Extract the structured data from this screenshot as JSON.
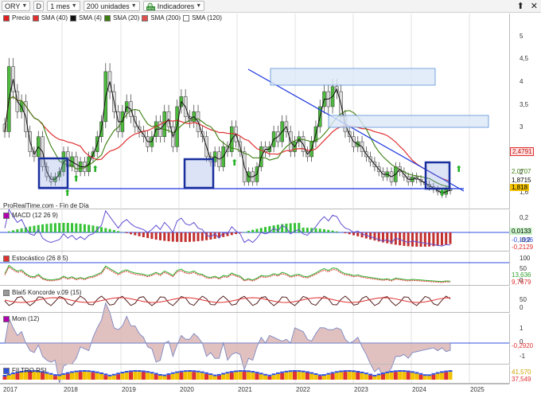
{
  "toolbar": {
    "ticker": "ORY",
    "d_label": "D",
    "period": "1 mes",
    "units": "200 unidades",
    "indicators": "Indicadores",
    "indicators_badge": "NEW"
  },
  "legend_main": [
    {
      "label": "Precio",
      "color": "#e02020"
    },
    {
      "label": "SMA (40)",
      "color": "#e03030"
    },
    {
      "label": "SMA (4)",
      "color": "#111111"
    },
    {
      "label": "SMA (20)",
      "color": "#3c7f10"
    },
    {
      "label": "SMA (200)",
      "color": "#e05050"
    },
    {
      "label": "SMA (120)",
      "color": "#ffffff"
    }
  ],
  "source_note": "ProRealTime.com - Fin de Día",
  "price_axis": [
    "5",
    "4,5",
    "4",
    "3,5",
    "3",
    "2",
    "1,6"
  ],
  "price_tags": [
    {
      "value": "2,4791",
      "color": "#e03030"
    },
    {
      "value": "2,0707",
      "color": "#3c7f10"
    },
    {
      "value": "1,8715",
      "color": "#111111"
    },
    {
      "value": "1,818",
      "color": "#f2c200"
    }
  ],
  "macd": {
    "title": "MACD (12 26 9)",
    "axis": [
      "0,2",
      "-0,2"
    ],
    "tags": [
      {
        "value": "0,0133",
        "color": "#30c030"
      },
      {
        "value": "-0,1996",
        "color": "#3050e0"
      },
      {
        "value": "-0,2129",
        "color": "#e03030"
      }
    ]
  },
  "stoch": {
    "title": "Estocástico (26 8 5)",
    "axis": [
      "100",
      "50",
      "0"
    ],
    "tags": [
      {
        "value": "13,636",
        "color": "#30c030"
      },
      {
        "value": "9,7679",
        "color": "#e03030"
      }
    ]
  },
  "blai": {
    "title": "Blai5 Koncorde v.09 (15)",
    "axis": [
      "50",
      "0"
    ]
  },
  "mom": {
    "title": "Mom (12)",
    "axis": [
      "1",
      "0",
      "-1"
    ],
    "tags": [
      {
        "value": "-0,2920",
        "color": "#e03030"
      }
    ]
  },
  "filtro": {
    "title": "FILTRO RSI",
    "tags": [
      {
        "value": "41,570",
        "color": "#f2c200"
      },
      {
        "value": "37,549",
        "color": "#e03030"
      }
    ]
  },
  "years": [
    "2017",
    "2018",
    "2019",
    "2020",
    "2021",
    "2022",
    "2023",
    "2024",
    "2025"
  ],
  "chart_data": {
    "type": "candlestick",
    "title": "ORY",
    "interval": "1 mes",
    "x_range": [
      "2017",
      "2025"
    ],
    "ylim": [
      1.45,
      5.2
    ],
    "y_ticks": [
      5,
      4.5,
      4,
      3.5,
      3,
      2,
      1.6
    ],
    "series": [
      {
        "name": "SMA (40)",
        "last": 2.4791
      },
      {
        "name": "SMA (20)",
        "last": 2.0707
      },
      {
        "name": "SMA (4)",
        "last": 1.8715
      }
    ],
    "last_price": 1.818,
    "macd": {
      "values": [
        0.0133,
        -0.1996,
        -0.2129
      ]
    },
    "stochastic": {
      "values": [
        13.636,
        9.7679
      ]
    },
    "momentum": {
      "values": [
        -0.292
      ]
    },
    "filtro_rsi": {
      "values": [
        41.57,
        37.549
      ]
    }
  }
}
